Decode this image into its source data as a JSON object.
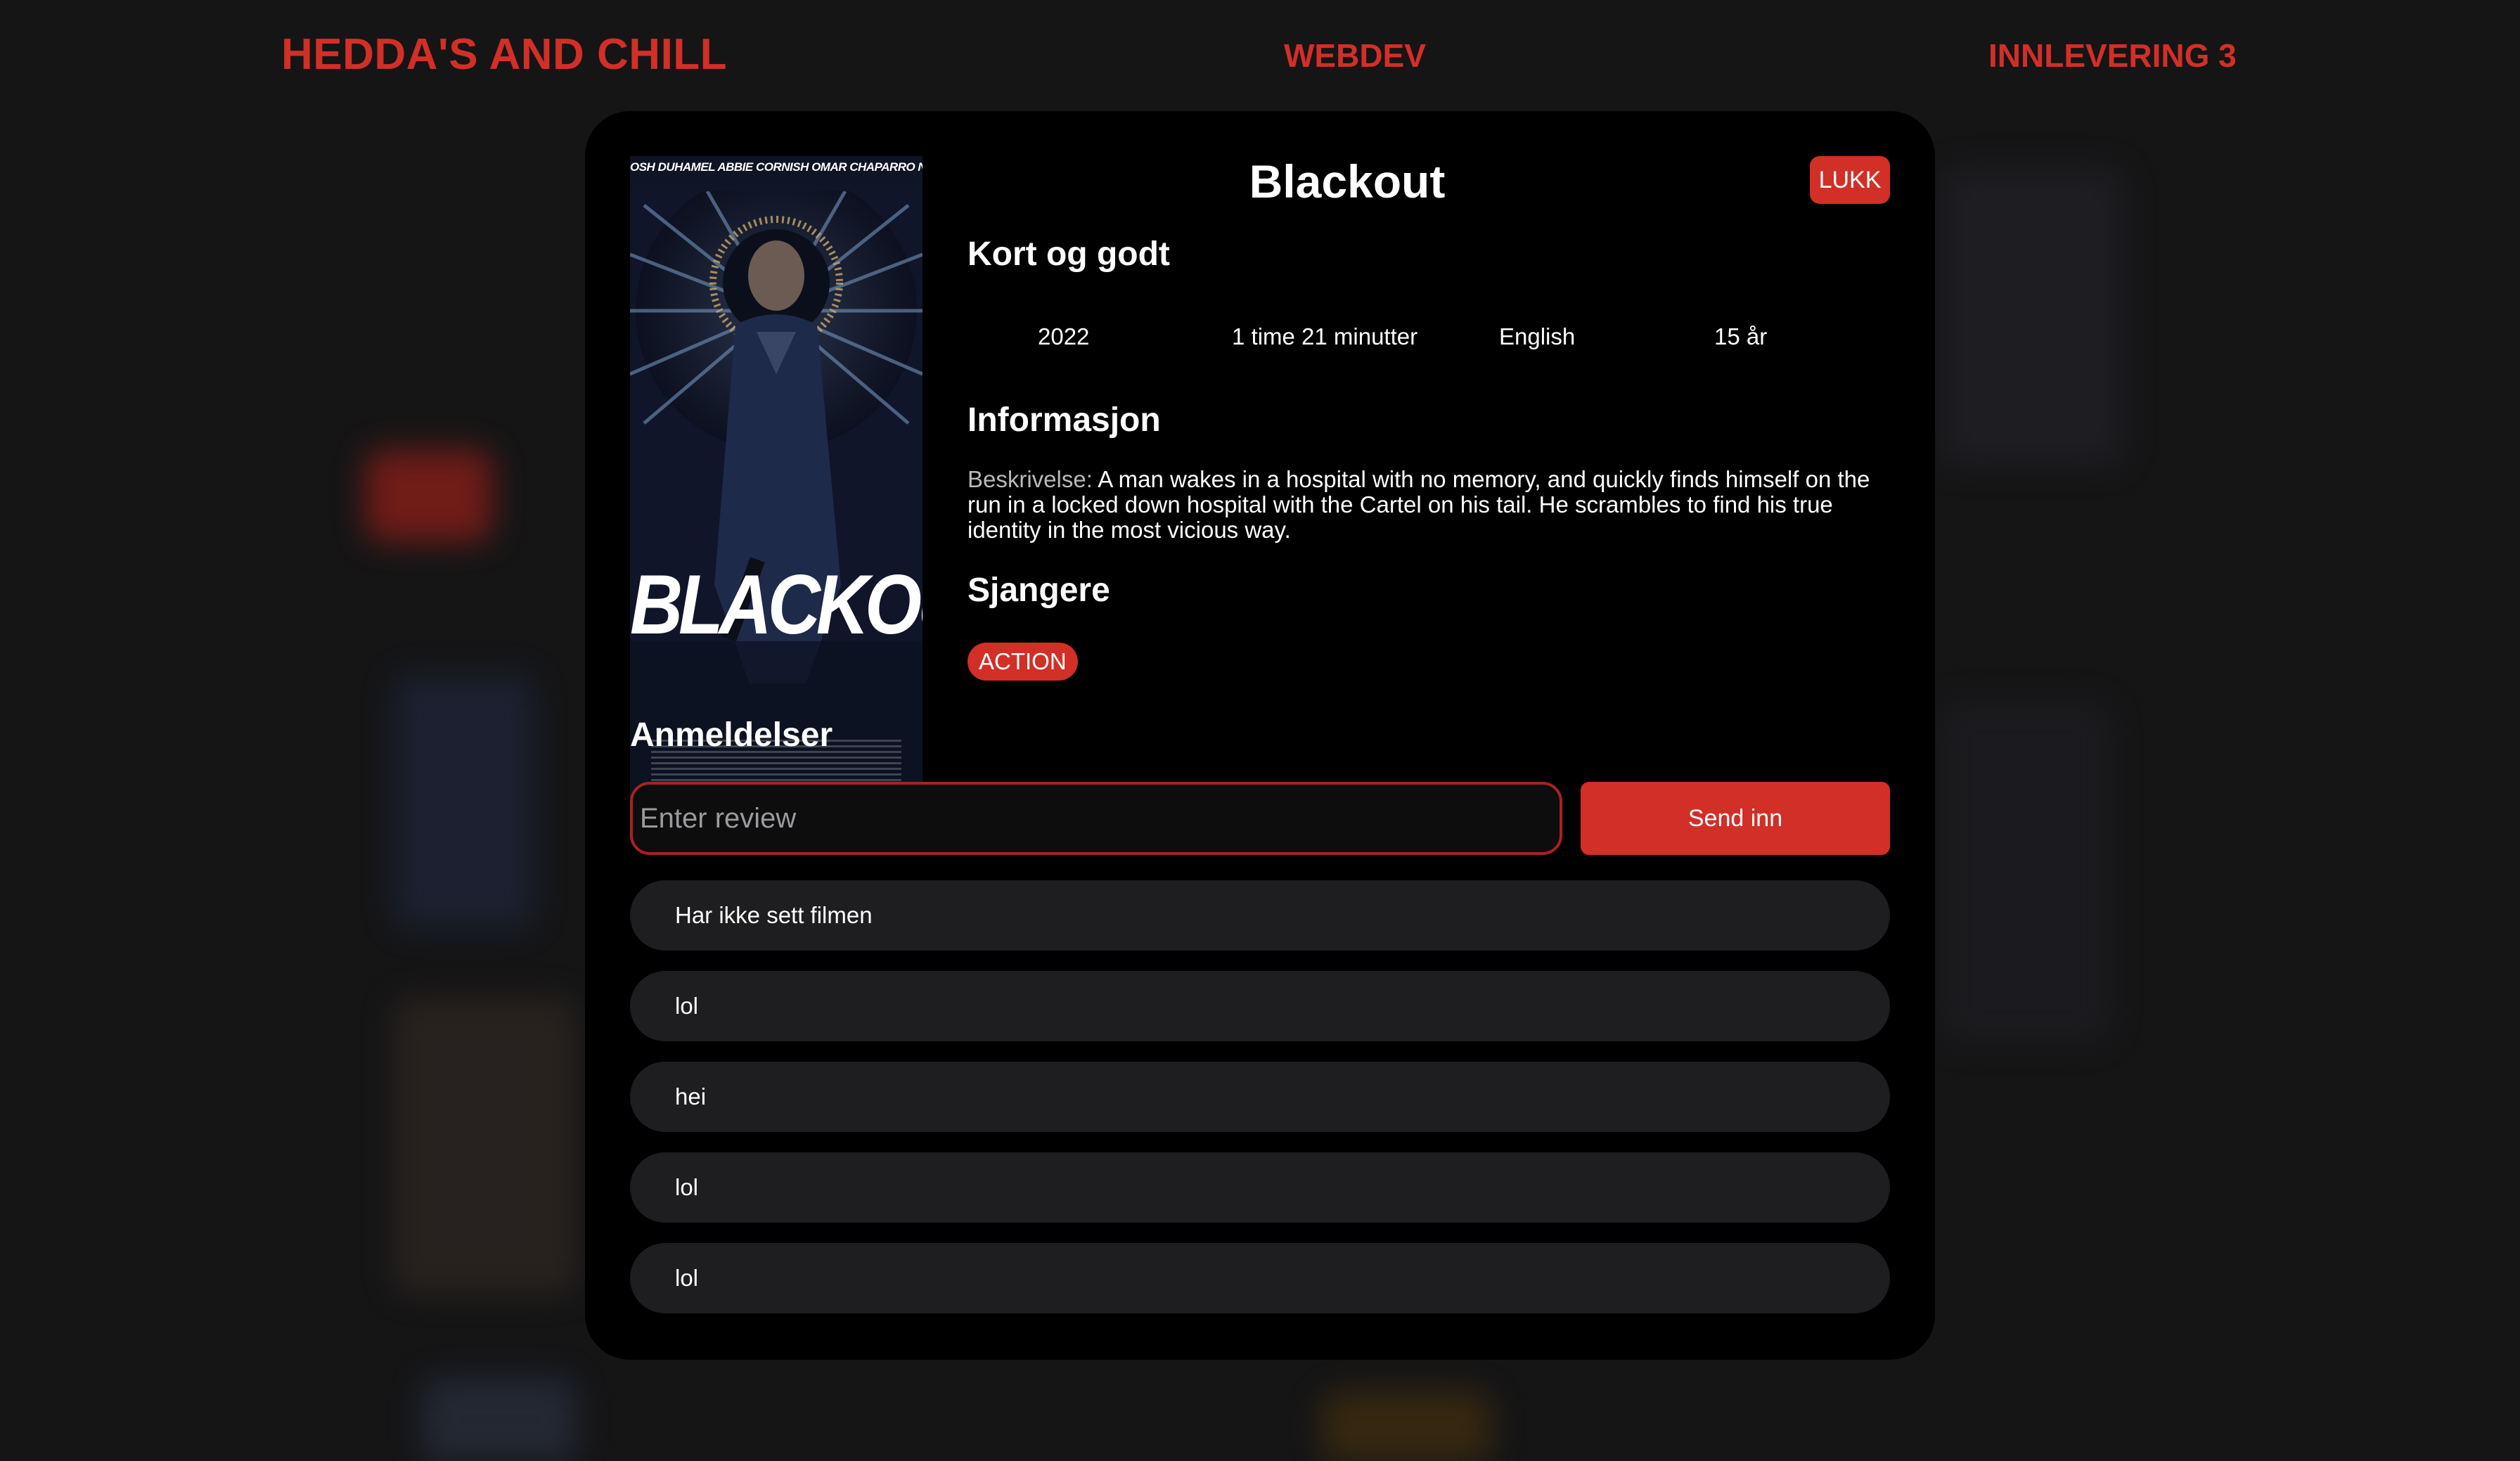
{
  "header": {
    "brand": "HEDDA'S AND CHILL",
    "nav": [
      "WEBDEV",
      "INNLEVERING 3"
    ]
  },
  "modal": {
    "title": "Blackout",
    "close_label": "LUKK",
    "poster": {
      "cast": "OSH DUHAMEL  ABBIE CORNISH  OMAR CHAPARRO  NICK NOLTE",
      "title": "BLACKOUT"
    },
    "sections": {
      "short": "Kort og godt",
      "info": "Informasjon",
      "genres": "Sjangere",
      "reviews": "Anmeldelser"
    },
    "facts": {
      "year": "2022",
      "length": "1 time 21 minutter",
      "language": "English",
      "age": "15 år"
    },
    "description": {
      "label": "Beskrivelse:",
      "text": "A man wakes in a hospital with no memory, and quickly finds himself on the run in a locked down hospital with the Cartel on his tail. He scrambles to find his true identity in the most vicious way."
    },
    "genre_tags": [
      "ACTION"
    ],
    "review_form": {
      "placeholder": "Enter review",
      "value": "",
      "submit_label": "Send inn"
    },
    "reviews": [
      "Har ikke sett filmen",
      "lol",
      "hei",
      "lol",
      "lol"
    ]
  },
  "colors": {
    "accent": "#d22f27",
    "background": "#151516",
    "modal": "#000000",
    "review_bubble": "#1e1e20"
  }
}
